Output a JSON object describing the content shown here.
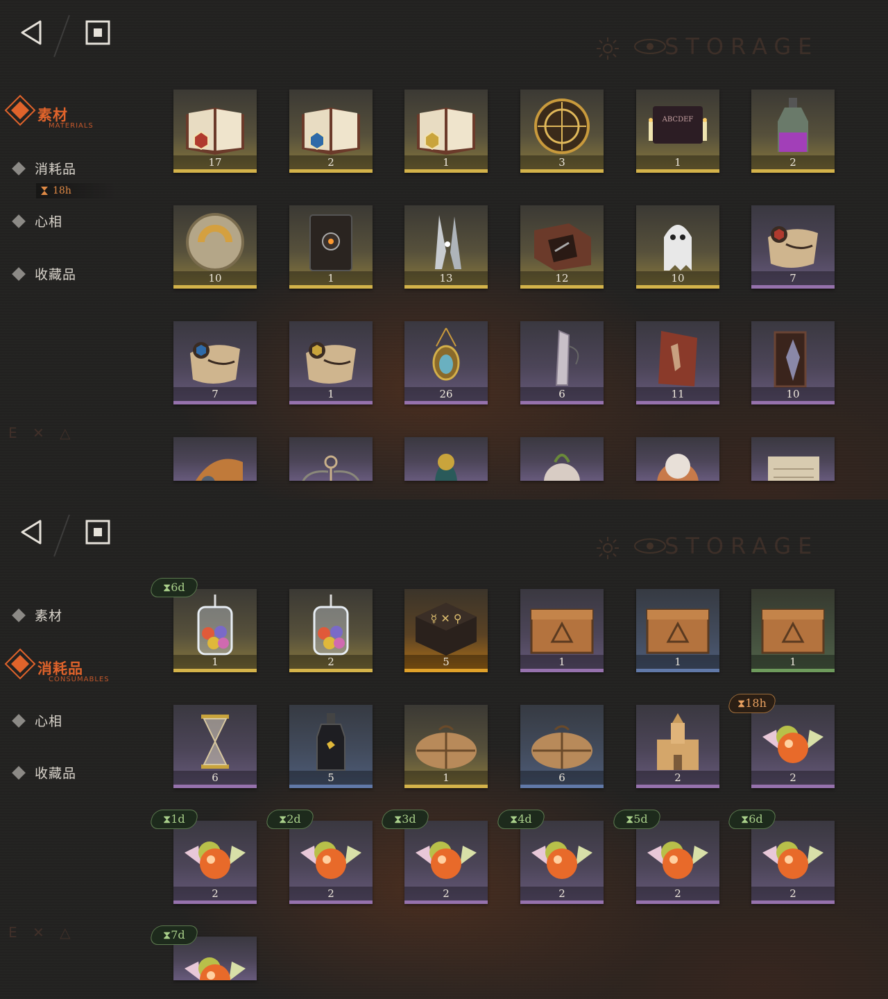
{
  "screens": [
    {
      "header": {
        "title": "STORAGE"
      },
      "categories": [
        {
          "label": "素材",
          "sub": "MATERIALS",
          "active": true
        },
        {
          "label": "消耗品",
          "sub": "",
          "active": false,
          "timer": "18h"
        },
        {
          "label": "心相",
          "sub": "",
          "active": false
        },
        {
          "label": "收藏品",
          "sub": "",
          "active": false
        }
      ],
      "items": [
        {
          "name": "book-red-icon",
          "count": "17",
          "rarity": "gold"
        },
        {
          "name": "book-blue-icon",
          "count": "2",
          "rarity": "gold"
        },
        {
          "name": "book-gold-icon",
          "count": "1",
          "rarity": "gold"
        },
        {
          "name": "astrolabe-icon",
          "count": "3",
          "rarity": "gold"
        },
        {
          "name": "ouija-board-icon",
          "count": "1",
          "rarity": "gold"
        },
        {
          "name": "potion-bottle-icon",
          "count": "2",
          "rarity": "gold"
        },
        {
          "name": "brass-disc-icon",
          "count": "10",
          "rarity": "gold"
        },
        {
          "name": "dark-tome-icon",
          "count": "1",
          "rarity": "gold"
        },
        {
          "name": "crossed-blades-icon",
          "count": "13",
          "rarity": "gold"
        },
        {
          "name": "hand-box-icon",
          "count": "12",
          "rarity": "gold"
        },
        {
          "name": "ghost-icon",
          "count": "10",
          "rarity": "gold"
        },
        {
          "name": "scroll-red-icon",
          "count": "7",
          "rarity": "purple"
        },
        {
          "name": "scroll-blue-icon",
          "count": "7",
          "rarity": "purple"
        },
        {
          "name": "scroll-gold-icon",
          "count": "1",
          "rarity": "purple"
        },
        {
          "name": "amulet-icon",
          "count": "26",
          "rarity": "purple"
        },
        {
          "name": "crystal-icon",
          "count": "6",
          "rarity": "purple"
        },
        {
          "name": "stone-tablet-icon",
          "count": "11",
          "rarity": "purple"
        },
        {
          "name": "frame-icon",
          "count": "10",
          "rarity": "purple"
        },
        {
          "name": "iron-helm-icon",
          "count": "",
          "rarity": "purple",
          "clipped": true
        },
        {
          "name": "winged-key-icon",
          "count": "",
          "rarity": "purple",
          "clipped": true
        },
        {
          "name": "bird-figurine-icon",
          "count": "",
          "rarity": "purple",
          "clipped": true
        },
        {
          "name": "plush-icon",
          "count": "",
          "rarity": "purple",
          "clipped": true
        },
        {
          "name": "mask-icon",
          "count": "",
          "rarity": "purple",
          "clipped": true
        },
        {
          "name": "parchment-icon",
          "count": "",
          "rarity": "purple",
          "clipped": true
        }
      ]
    },
    {
      "header": {
        "title": "STORAGE"
      },
      "categories": [
        {
          "label": "素材",
          "sub": "",
          "active": false
        },
        {
          "label": "消耗品",
          "sub": "CONSUMABLES",
          "active": true
        },
        {
          "label": "心相",
          "sub": "",
          "active": false
        },
        {
          "label": "收藏品",
          "sub": "",
          "active": false
        }
      ],
      "items": [
        {
          "name": "candy-jar-icon",
          "count": "1",
          "rarity": "gold",
          "timer": "6d"
        },
        {
          "name": "candy-jar-icon",
          "count": "2",
          "rarity": "gold"
        },
        {
          "name": "rune-box-icon",
          "count": "5",
          "rarity": "orange"
        },
        {
          "name": "wooden-crate-icon",
          "count": "1",
          "rarity": "purple"
        },
        {
          "name": "wooden-crate-icon",
          "count": "1",
          "rarity": "blue"
        },
        {
          "name": "wooden-crate-icon",
          "count": "1",
          "rarity": "green"
        },
        {
          "name": "hourglass-icon",
          "count": "6",
          "rarity": "purple"
        },
        {
          "name": "bottle-icon",
          "count": "5",
          "rarity": "blue"
        },
        {
          "name": "parcel-icon",
          "count": "1",
          "rarity": "gold"
        },
        {
          "name": "parcel-icon",
          "count": "6",
          "rarity": "blue"
        },
        {
          "name": "sand-castle-icon",
          "count": "2",
          "rarity": "purple"
        },
        {
          "name": "candy-icon",
          "count": "2",
          "rarity": "purple",
          "timer": "18h",
          "timer_style": "orange"
        },
        {
          "name": "candy-icon",
          "count": "2",
          "rarity": "purple",
          "timer": "1d"
        },
        {
          "name": "candy-icon",
          "count": "2",
          "rarity": "purple",
          "timer": "2d"
        },
        {
          "name": "candy-icon",
          "count": "2",
          "rarity": "purple",
          "timer": "3d"
        },
        {
          "name": "candy-icon",
          "count": "2",
          "rarity": "purple",
          "timer": "4d"
        },
        {
          "name": "candy-icon",
          "count": "2",
          "rarity": "purple",
          "timer": "5d"
        },
        {
          "name": "candy-icon",
          "count": "2",
          "rarity": "purple",
          "timer": "6d"
        },
        {
          "name": "candy-icon",
          "count": "",
          "rarity": "purple",
          "timer": "7d",
          "clipped": true
        }
      ]
    }
  ],
  "colors": {
    "accent": "#e0632b",
    "gold": "#d4b34a",
    "purple": "#9672ad",
    "blue": "#6179a8",
    "green": "#6e9a5c",
    "orange": "#e0a12a",
    "timer_green": "#a9d08a"
  }
}
